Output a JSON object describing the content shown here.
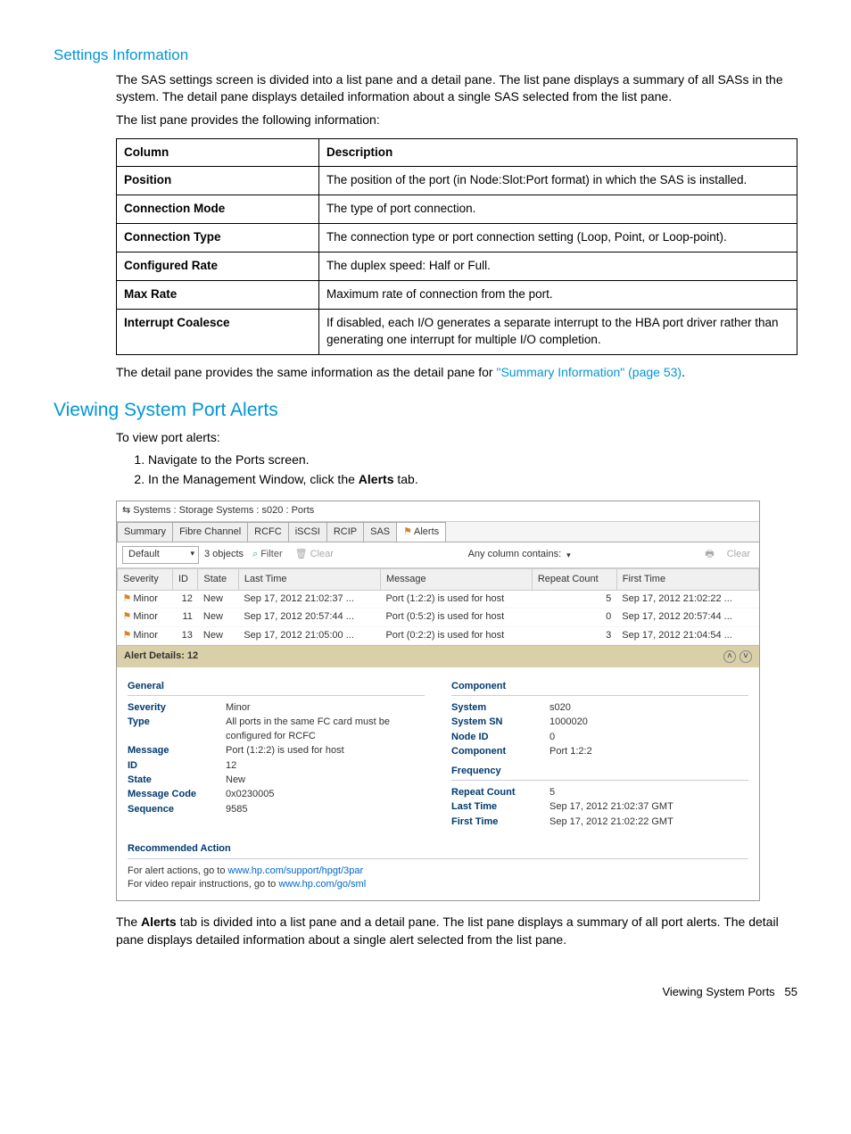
{
  "headings": {
    "settings_info": "Settings Information",
    "viewing_alerts": "Viewing System Port Alerts"
  },
  "paras": {
    "p1": "The SAS settings screen is divided into a list pane and a detail pane. The list pane displays a summary of all SASs in the system. The detail pane displays detailed information about a single SAS selected from the list pane.",
    "p2": "The list pane provides the following information:",
    "p3a": "The detail pane provides the same information as the detail pane for ",
    "p3_link": "\"Summary Information\" (page 53)",
    "p3b": ".",
    "p4": "To view port alerts:",
    "p5a": "The ",
    "p5_bold": "Alerts",
    "p5b": " tab is divided into a list pane and a detail pane. The list pane displays a summary of all port alerts. The detail pane displays detailed information about a single alert selected from the list pane."
  },
  "steps": {
    "s1": "Navigate to the Ports screen.",
    "s2a": "In the Management Window, click the ",
    "s2_bold": "Alerts",
    "s2b": " tab."
  },
  "table": {
    "head_col": "Column",
    "head_desc": "Description",
    "rows": [
      {
        "c": "Position",
        "d": "The position of the port (in Node:Slot:Port format) in which the SAS is installed."
      },
      {
        "c": "Connection Mode",
        "d": "The type of port connection."
      },
      {
        "c": "Connection Type",
        "d": "The connection type or port connection setting (Loop, Point, or Loop-point)."
      },
      {
        "c": "Configured Rate",
        "d": "The duplex speed: Half or Full."
      },
      {
        "c": "Max Rate",
        "d": "Maximum rate of connection from the port."
      },
      {
        "c": "Interrupt Coalesce",
        "d": "If disabled, each I/O generates a separate interrupt to the HBA port driver rather than generating one interrupt for multiple I/O completion."
      }
    ]
  },
  "screenshot": {
    "breadcrumb_icon": "⇆",
    "breadcrumb": "Systems : Storage Systems : s020 : Ports",
    "tabs": [
      "Summary",
      "Fibre Channel",
      "RCFC",
      "iSCSI",
      "RCIP",
      "SAS",
      "Alerts"
    ],
    "active_tab_index": 6,
    "toolbar": {
      "default_label": "Default",
      "objects": "3 objects",
      "filter": "Filter",
      "clear": "Clear",
      "search_label": "Any column contains:",
      "print_icon": "🖶",
      "clear2": "Clear"
    },
    "grid": {
      "headers": [
        "Severity",
        "ID",
        "State",
        "Last Time",
        "Message",
        "Repeat Count",
        "First Time"
      ],
      "rows": [
        {
          "sev": "Minor",
          "id": "12",
          "state": "New",
          "last": "Sep 17, 2012 21:02:37 ...",
          "msg": "Port (1:2:2) is used for host",
          "rc": "5",
          "first": "Sep 17, 2012 21:02:22 ..."
        },
        {
          "sev": "Minor",
          "id": "11",
          "state": "New",
          "last": "Sep 17, 2012 20:57:44 ...",
          "msg": "Port (0:5:2) is used for host",
          "rc": "0",
          "first": "Sep 17, 2012 20:57:44 ..."
        },
        {
          "sev": "Minor",
          "id": "13",
          "state": "New",
          "last": "Sep 17, 2012 21:05:00 ...",
          "msg": "Port (0:2:2) is used for host",
          "rc": "3",
          "first": "Sep 17, 2012 21:04:54 ..."
        }
      ]
    },
    "details": {
      "title": "Alert Details: 12",
      "sect_general": "General",
      "sect_component": "Component",
      "sect_frequency": "Frequency",
      "sect_reco": "Recommended Action",
      "general": {
        "Severity": "Minor",
        "Type": "All ports in the same FC card must be configured for RCFC",
        "Message": "Port (1:2:2) is used for host",
        "ID": "12",
        "State": "New",
        "MessageCode_k": "Message Code",
        "MessageCode": "0x0230005",
        "Sequence": "9585"
      },
      "component": {
        "System": "s020",
        "SystemSN_k": "System SN",
        "SystemSN": "1000020",
        "NodeID_k": "Node ID",
        "NodeID": "0",
        "Component": "Port 1:2:2"
      },
      "frequency": {
        "RepeatCount_k": "Repeat Count",
        "RepeatCount": "5",
        "LastTime_k": "Last Time",
        "LastTime": "Sep 17, 2012 21:02:37 GMT",
        "FirstTime_k": "First Time",
        "FirstTime": "Sep 17, 2012 21:02:22 GMT"
      },
      "reco": {
        "line1a": "For alert actions, go to ",
        "link1": "www.hp.com/support/hpgt/3par",
        "line2a": "For video repair instructions, go to ",
        "link2": "www.hp.com/go/sml"
      }
    }
  },
  "footer": {
    "section": "Viewing System Ports",
    "page": "55"
  }
}
